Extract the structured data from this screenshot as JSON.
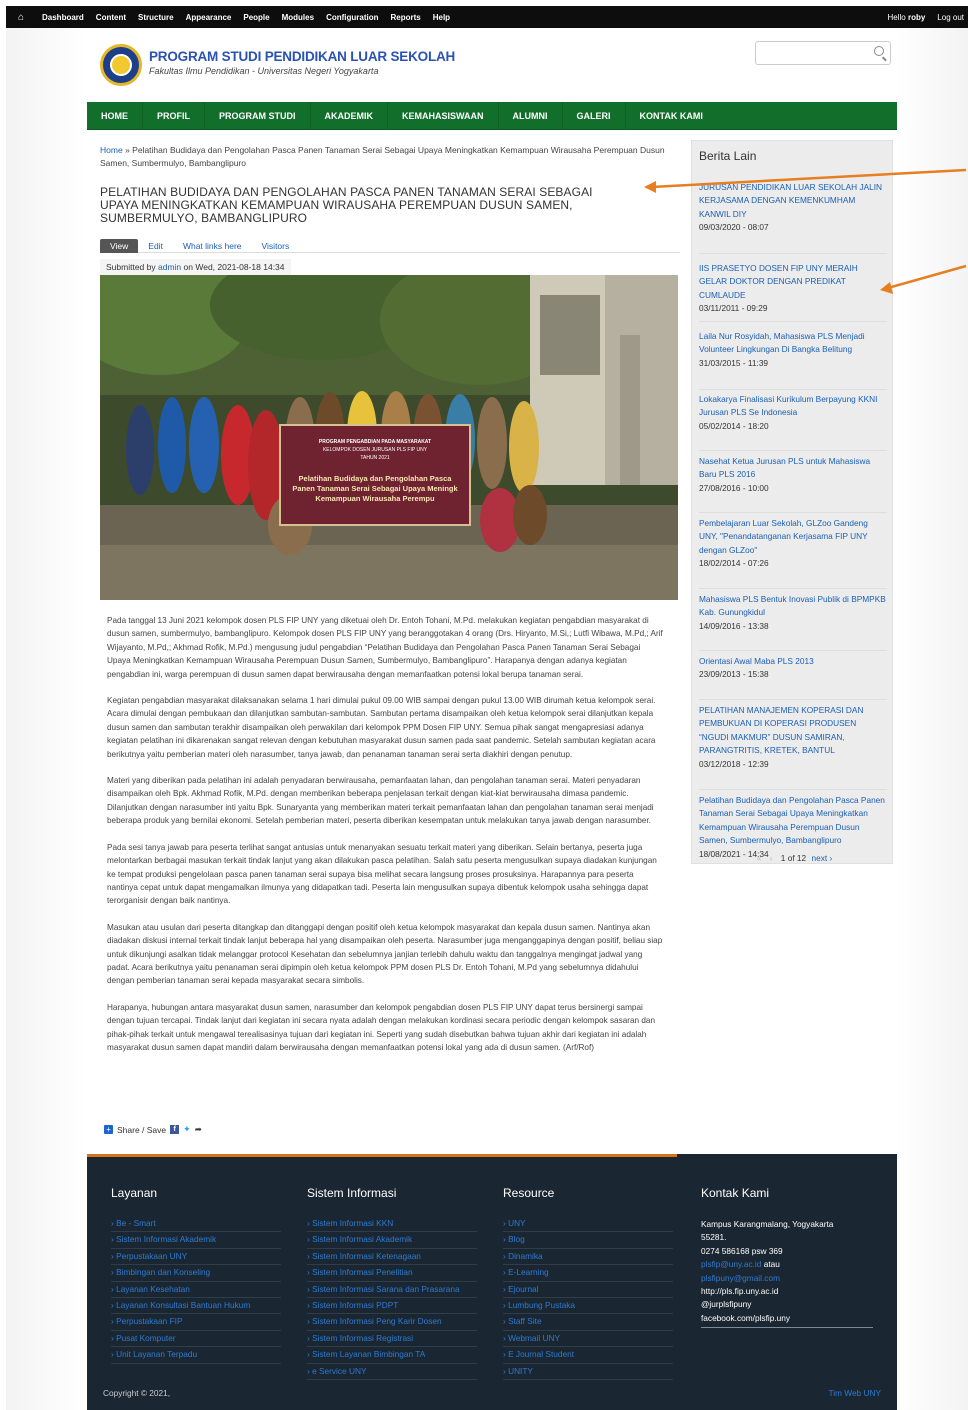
{
  "admin_bar": {
    "items": [
      "Dashboard",
      "Content",
      "Structure",
      "Appearance",
      "People",
      "Modules",
      "Configuration",
      "Reports",
      "Help"
    ],
    "greeting_prefix": "Hello",
    "user": "roby",
    "logout": "Log out"
  },
  "header": {
    "site_name": "PROGRAM STUDI PENDIDIKAN LUAR SEKOLAH",
    "slogan": "Fakultas Ilmu Pendidikan - Universitas Negeri Yogyakarta",
    "search_placeholder": ""
  },
  "nav": [
    "HOME",
    "PROFIL",
    "PROGRAM STUDI",
    "AKADEMIK",
    "KEMAHASISWAAN",
    "ALUMNI",
    "GALERI",
    "KONTAK KAMI"
  ],
  "breadcrumb": {
    "home": "Home",
    "separator": "»",
    "current": "Pelatihan Budidaya dan Pengolahan Pasca Panen Tanaman Serai Sebagai Upaya Meningkatkan Kemampuan Wirausaha Perempuan Dusun Samen, Sumbermulyo, Bambanglipuro"
  },
  "article": {
    "title": "PELATIHAN BUDIDAYA DAN PENGOLAHAN PASCA PANEN TANAMAN SERAI SEBAGAI UPAYA MENINGKATKAN KEMAMPUAN WIRAUSAHA PEREMPUAN DUSUN SAMEN, SUMBERMULYO, BAMBANGLIPURO",
    "tabs": [
      "View",
      "Edit",
      "What links here",
      "Visitors"
    ],
    "submitted_prefix": "Submitted by",
    "author": "admin",
    "submitted_suffix": "on Wed, 2021-08-18 14:34",
    "banner_text": {
      "line1": "PROGRAM PENGABDIAN PADA MASYARAKAT",
      "line2": "KELOMPOK DOSEN JURUSAN PLS FIP UNY",
      "line3": "TAHUN 2021",
      "heading1": "Pelatihan Budidaya dan Pengolahan Pasca",
      "heading2": "Panen Tanaman Serai Sebagai Upaya Meningk",
      "heading3": "Kemampuan Wirausaha Perempu"
    },
    "paragraphs": [
      "Pada tanggal 13 Juni 2021 kelompok dosen PLS FIP UNY yang diketuai oleh Dr. Entoh Tohani, M.Pd. melakukan kegiatan pengabdian masyarakat di dusun samen, sumbermulyo, bambanglipuro. Kelompok dosen PLS FIP UNY yang beranggotakan 4 orang (Drs. Hiryanto, M.Si,; Lutfi Wibawa, M.Pd,; Arif Wijayanto, M.Pd,; Akhmad Rofik, M.Pd.) mengusung judul pengabdian “Pelatihan Budidaya dan Pengolahan Pasca Panen Tanaman Serai Sebagai Upaya Meningkatkan Kemampuan Wirausaha Perempuan Dusun Samen, Sumbermulyo, Bambanglipuro”. Harapanya dengan adanya kegiatan pengabdian ini, warga perempuan di dusun samen dapat berwirausaha dengan memanfaatkan potensi lokal berupa tanaman serai.",
      "Kegiatan pengabdian masyarakat dilaksanakan selama 1 hari dimulai pukul 09.00 WIB sampai dengan pukul 13.00 WIB dirumah ketua kelompok serai. Acara dimulai dengan pembukaan dan dilanjutkan sambutan-sambutan. Sambutan pertama disampaikan oleh ketua kelompok serai dilanjutkan kepala dusun samen dan sambutan terakhir disampaikan oleh perwakilan dari kelompok PPM Dosen FIP UNY. Semua pihak sangat mengapresiasi adanya kegiatan pelatihan ini dikarenakan sangat relevan dengan kebutuhan masyarakat dusun samen pada saat pandemic. Setelah sambutan kegiatan acara berikutnya yaitu pemberian materi oleh narasumber, tanya jawab, dan penanaman tanaman serai serta diakhiri dengan penutup.",
      "Materi yang diberikan pada pelatihan ini adalah penyadaran berwirausaha, pemanfaatan lahan, dan pengolahan tanaman serai. Materi penyadaran disampaikan oleh Bpk. Akhmad Rofik, M.Pd. dengan memberikan beberapa penjelasan terkait dengan kiat-kiat berwirausaha dimasa pandemic. Dilanjutkan dengan narasumber inti yaitu Bpk. Sunaryanta yang memberikan materi terkait pemanfaatan lahan dan pengolahan tanaman serai menjadi beberapa produk yang bernilai ekonomi. Setelah pemberian materi, peserta diberikan kesempatan untuk melakukan tanya jawab dengan narasumber.",
      "Pada sesi tanya jawab para peserta terlihat sangat antusias untuk menanyakan sesuatu terkait materi yang diberikan. Selain bertanya, peserta juga melontarkan berbagai masukan terkait tindak lanjut yang akan dilakukan pasca pelatihan. Salah satu peserta mengusulkan supaya diadakan kunjungan ke tempat produksi pengelolaan pasca panen tanaman serai supaya bisa melihat secara langsung proses prosuksinya. Harapannya para peserta nantinya cepat untuk dapat mengamalkan ilmunya yang didapatkan tadi. Peserta lain mengusulkan supaya dibentuk kelompok usaha sehingga dapat terorganisir dengan baik nantinya.",
      "Masukan atau usulan dari peserta ditangkap dan ditanggapi dengan positif oleh ketua kelompok masyarakat dan kepala dusun samen. Nantinya akan diadakan diskusi internal terkait tindak lanjut beberapa hal yang disampaikan oleh peserta. Narasumber juga menganggapinya dengan positif, beliau siap untuk dikunjungi asalkan tidak melanggar protocol Kesehatan dan sebelumnya janjian terlebih dahulu waktu dan tanggalnya mengingat jadwal yang padat. Acara berikutnya yaitu penanaman serai dipimpin oleh ketua kelompok PPM dosen PLS Dr. Entoh Tohani, M.Pd yang sebelumnya didahului dengan pemberian tanaman serai kepada masyarakat secara simbolis.",
      "Harapanya, hubungan antara masyarakat dusun samen, narasumber dan kelompok pengabdian dosen PLS FIP UNY dapat terus bersinergi sampai dengan tujuan tercapai. Tindak lanjut dari kegiatan ini secara nyata adalah dengan melakukan kordinasi secara periodic dengan kelompok sasaran dan pihak-pihak terkait untuk mengawal terealisasinya tujuan dari kegiatan ini. Seperti yang sudah disebutkan bahwa tujuan akhir dari kegiatan ini adalah masyarakat dusun samen dapat mandiri dalam berwirausaha dengan memanfaatkan potensi lokal yang ada di dusun samen. (Arf/Rof)"
    ],
    "share_label": "Share / Save"
  },
  "sidebar": {
    "title": "Berita Lain",
    "items": [
      {
        "title": "JURUSAN PENDIDIKAN LUAR SEKOLAH JALIN KERJASAMA DENGAN KEMENKUMHAM KANWIL DIY",
        "date": "09/03/2020 - 08:07"
      },
      {
        "title": "IIS PRASETYO DOSEN FIP UNY MERAIH GELAR DOKTOR DENGAN PREDIKAT CUMLAUDE",
        "date": "03/11/2011 - 09:29"
      },
      {
        "title": "Laila Nur Rosyidah, Mahasiswa PLS Menjadi Volunteer Lingkungan Di Bangka Belitung",
        "date": "31/03/2015 - 11:39"
      },
      {
        "title": "Lokakarya Finalisasi Kurikulum Berpayung KKNI Jurusan PLS Se Indonesia",
        "date": "05/02/2014 - 18:20"
      },
      {
        "title": "Nasehat Ketua Jurusan PLS untuk Mahasiswa Baru PLS 2016",
        "date": "27/08/2016 - 10:00"
      },
      {
        "title": "Pembelajaran Luar Sekolah, GLZoo Gandeng UNY, \"Penandatanganan Kerjasama FIP UNY dengan GLZoo\"",
        "date": "18/02/2014 - 07:26"
      },
      {
        "title": "Mahasiswa PLS Bentuk Inovasi Publik di BPMPKB Kab. Gunungkidul",
        "date": "14/09/2016 - 13:38"
      },
      {
        "title": "Orientasi Awal Maba PLS 2013",
        "date": "23/09/2013 - 15:38"
      },
      {
        "title": "PELATIHAN MANAJEMEN KOPERASI DAN PEMBUKUAN DI KOPERASI PRODUSEN “NGUDI MAKMUR” DUSUN SAMIRAN, PARANGTRITIS, KRETEK, BANTUL",
        "date": "03/12/2018 - 12:39"
      },
      {
        "title": "Pelatihan Budidaya dan Pengolahan Pasca Panen Tanaman Serai Sebagai Upaya Meningkatkan Kemampuan Wirausaha Perempuan Dusun Samen, Sumbermulyo, Bambanglipuro",
        "date": "18/08/2021 - 14:34"
      }
    ],
    "pager": {
      "first": "«",
      "prev": "‹",
      "status": "1 of 12",
      "next": "next ›"
    }
  },
  "footer": {
    "columns": [
      {
        "title": "Layanan",
        "items": [
          "Be - Smart",
          "Sistem Informasi Akademik",
          "Perpustakaan UNY",
          "Bimbingan dan Konseling",
          "Layanan Kesehatan",
          "Layanan Konsultasi Bantuan Hukum",
          "Perpustakaan FIP",
          "Pusat Komputer",
          "Unit Layanan Terpadu"
        ]
      },
      {
        "title": "Sistem Informasi",
        "items": [
          "Sistem Informasi KKN",
          "Sistem Informasi Akademik",
          "Sistem Informasi Ketenagaan",
          "Sistem Informasi Penelitian",
          "Sistem Informasi Sarana dan Prasarana",
          "Sistem Informasi PDPT",
          "Sistem Informasi Peng Karir Dosen",
          "Sistem Informasi Registrasi",
          "Sistem Layanan Bimbingan TA",
          "e Service UNY"
        ]
      },
      {
        "title": "Resource",
        "items": [
          "UNY",
          "Blog",
          "Dinamika",
          "E-Learning",
          "Ejournal",
          "Lumbung Pustaka",
          "Staff Site",
          "Webmail UNY",
          "E Journal Student",
          "UNITY"
        ]
      }
    ],
    "contact": {
      "title": "Kontak Kami",
      "address1": "Kampus Karangmalang, Yogyakarta",
      "address2": "55281.",
      "phone": "0274 586168 psw 369",
      "email1": "plsfip@uny.ac.id",
      "email_sep": "atau",
      "email2": "plsfipuny@gmail.com",
      "website": "http://pls.fip.uny.ac.id",
      "twitter": "@jurplsfipuny",
      "facebook": "facebook.com/plsfip.uny"
    },
    "copyright": "Copyright © 2021,",
    "credits": "Tim Web UNY"
  },
  "colors": {
    "nav_green": "#126f2b",
    "link_blue": "#1a5fb4",
    "footer_bg": "#1a2733",
    "accent_orange": "#e67e22",
    "admin_bar": "#0d0d0d"
  }
}
